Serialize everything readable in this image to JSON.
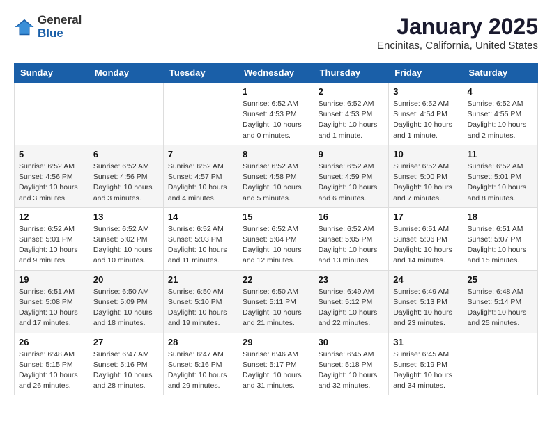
{
  "logo": {
    "general": "General",
    "blue": "Blue"
  },
  "header": {
    "title": "January 2025",
    "subtitle": "Encinitas, California, United States"
  },
  "days_of_week": [
    "Sunday",
    "Monday",
    "Tuesday",
    "Wednesday",
    "Thursday",
    "Friday",
    "Saturday"
  ],
  "weeks": [
    [
      {
        "day": "",
        "info": ""
      },
      {
        "day": "",
        "info": ""
      },
      {
        "day": "",
        "info": ""
      },
      {
        "day": "1",
        "info": "Sunrise: 6:52 AM\nSunset: 4:53 PM\nDaylight: 10 hours\nand 0 minutes."
      },
      {
        "day": "2",
        "info": "Sunrise: 6:52 AM\nSunset: 4:53 PM\nDaylight: 10 hours\nand 1 minute."
      },
      {
        "day": "3",
        "info": "Sunrise: 6:52 AM\nSunset: 4:54 PM\nDaylight: 10 hours\nand 1 minute."
      },
      {
        "day": "4",
        "info": "Sunrise: 6:52 AM\nSunset: 4:55 PM\nDaylight: 10 hours\nand 2 minutes."
      }
    ],
    [
      {
        "day": "5",
        "info": "Sunrise: 6:52 AM\nSunset: 4:56 PM\nDaylight: 10 hours\nand 3 minutes."
      },
      {
        "day": "6",
        "info": "Sunrise: 6:52 AM\nSunset: 4:56 PM\nDaylight: 10 hours\nand 3 minutes."
      },
      {
        "day": "7",
        "info": "Sunrise: 6:52 AM\nSunset: 4:57 PM\nDaylight: 10 hours\nand 4 minutes."
      },
      {
        "day": "8",
        "info": "Sunrise: 6:52 AM\nSunset: 4:58 PM\nDaylight: 10 hours\nand 5 minutes."
      },
      {
        "day": "9",
        "info": "Sunrise: 6:52 AM\nSunset: 4:59 PM\nDaylight: 10 hours\nand 6 minutes."
      },
      {
        "day": "10",
        "info": "Sunrise: 6:52 AM\nSunset: 5:00 PM\nDaylight: 10 hours\nand 7 minutes."
      },
      {
        "day": "11",
        "info": "Sunrise: 6:52 AM\nSunset: 5:01 PM\nDaylight: 10 hours\nand 8 minutes."
      }
    ],
    [
      {
        "day": "12",
        "info": "Sunrise: 6:52 AM\nSunset: 5:01 PM\nDaylight: 10 hours\nand 9 minutes."
      },
      {
        "day": "13",
        "info": "Sunrise: 6:52 AM\nSunset: 5:02 PM\nDaylight: 10 hours\nand 10 minutes."
      },
      {
        "day": "14",
        "info": "Sunrise: 6:52 AM\nSunset: 5:03 PM\nDaylight: 10 hours\nand 11 minutes."
      },
      {
        "day": "15",
        "info": "Sunrise: 6:52 AM\nSunset: 5:04 PM\nDaylight: 10 hours\nand 12 minutes."
      },
      {
        "day": "16",
        "info": "Sunrise: 6:52 AM\nSunset: 5:05 PM\nDaylight: 10 hours\nand 13 minutes."
      },
      {
        "day": "17",
        "info": "Sunrise: 6:51 AM\nSunset: 5:06 PM\nDaylight: 10 hours\nand 14 minutes."
      },
      {
        "day": "18",
        "info": "Sunrise: 6:51 AM\nSunset: 5:07 PM\nDaylight: 10 hours\nand 15 minutes."
      }
    ],
    [
      {
        "day": "19",
        "info": "Sunrise: 6:51 AM\nSunset: 5:08 PM\nDaylight: 10 hours\nand 17 minutes."
      },
      {
        "day": "20",
        "info": "Sunrise: 6:50 AM\nSunset: 5:09 PM\nDaylight: 10 hours\nand 18 minutes."
      },
      {
        "day": "21",
        "info": "Sunrise: 6:50 AM\nSunset: 5:10 PM\nDaylight: 10 hours\nand 19 minutes."
      },
      {
        "day": "22",
        "info": "Sunrise: 6:50 AM\nSunset: 5:11 PM\nDaylight: 10 hours\nand 21 minutes."
      },
      {
        "day": "23",
        "info": "Sunrise: 6:49 AM\nSunset: 5:12 PM\nDaylight: 10 hours\nand 22 minutes."
      },
      {
        "day": "24",
        "info": "Sunrise: 6:49 AM\nSunset: 5:13 PM\nDaylight: 10 hours\nand 23 minutes."
      },
      {
        "day": "25",
        "info": "Sunrise: 6:48 AM\nSunset: 5:14 PM\nDaylight: 10 hours\nand 25 minutes."
      }
    ],
    [
      {
        "day": "26",
        "info": "Sunrise: 6:48 AM\nSunset: 5:15 PM\nDaylight: 10 hours\nand 26 minutes."
      },
      {
        "day": "27",
        "info": "Sunrise: 6:47 AM\nSunset: 5:16 PM\nDaylight: 10 hours\nand 28 minutes."
      },
      {
        "day": "28",
        "info": "Sunrise: 6:47 AM\nSunset: 5:16 PM\nDaylight: 10 hours\nand 29 minutes."
      },
      {
        "day": "29",
        "info": "Sunrise: 6:46 AM\nSunset: 5:17 PM\nDaylight: 10 hours\nand 31 minutes."
      },
      {
        "day": "30",
        "info": "Sunrise: 6:45 AM\nSunset: 5:18 PM\nDaylight: 10 hours\nand 32 minutes."
      },
      {
        "day": "31",
        "info": "Sunrise: 6:45 AM\nSunset: 5:19 PM\nDaylight: 10 hours\nand 34 minutes."
      },
      {
        "day": "",
        "info": ""
      }
    ]
  ]
}
